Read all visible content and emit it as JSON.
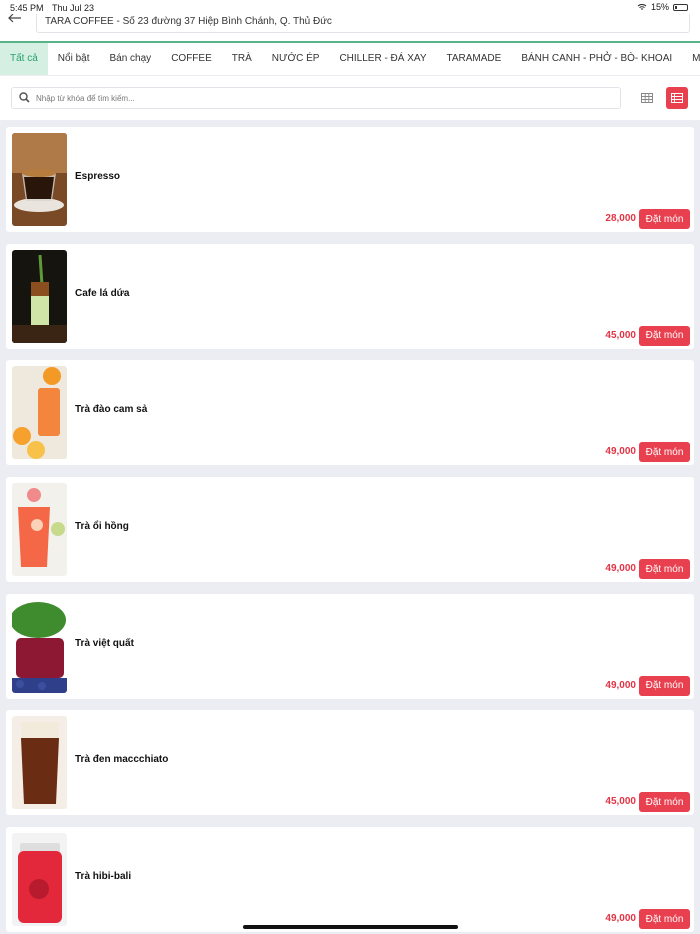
{
  "status_bar": {
    "time": "5:45 PM",
    "date": "Thu Jul 23",
    "battery": "15%"
  },
  "header": {
    "back_icon": "arrow-left-icon",
    "address": "TARA COFFEE - Số 23 đường 37 Hiệp Bình Chánh, Q. Thủ Đức"
  },
  "tabs": [
    {
      "label": "Tất cả",
      "active": true
    },
    {
      "label": "Nổi bật"
    },
    {
      "label": "Bán chạy"
    },
    {
      "label": "COFFEE"
    },
    {
      "label": "TRÀ"
    },
    {
      "label": "NƯỚC ÉP"
    },
    {
      "label": "CHILLER - ĐÁ XAY"
    },
    {
      "label": "TARAMADE"
    },
    {
      "label": "BÁNH CANH - PHỞ - BÒ- KHOAI"
    },
    {
      "label": "MÓN THÊM"
    }
  ],
  "search": {
    "placeholder": "Nhập từ khóa để tìm kiếm...",
    "value": ""
  },
  "view_toggle": {
    "grid_icon": "grid-view-icon",
    "list_icon": "list-view-icon",
    "selected": "list"
  },
  "products": [
    {
      "name": "Espresso",
      "price": "28,000",
      "order_label": "Đặt món"
    },
    {
      "name": "Cafe lá dứa",
      "price": "45,000",
      "order_label": "Đặt món"
    },
    {
      "name": "Trà đào cam sả",
      "price": "49,000",
      "order_label": "Đặt món"
    },
    {
      "name": "Trà ổi hồng",
      "price": "49,000",
      "order_label": "Đặt món"
    },
    {
      "name": "Trà việt quất",
      "price": "49,000",
      "order_label": "Đặt món"
    },
    {
      "name": "Trà đen maccchiato",
      "price": "45,000",
      "order_label": "Đặt món"
    },
    {
      "name": "Trà hibi-bali",
      "price": "49,000",
      "order_label": "Đặt món"
    }
  ],
  "colors": {
    "accent_green": "#58b58a",
    "accent_red": "#e8404f"
  }
}
